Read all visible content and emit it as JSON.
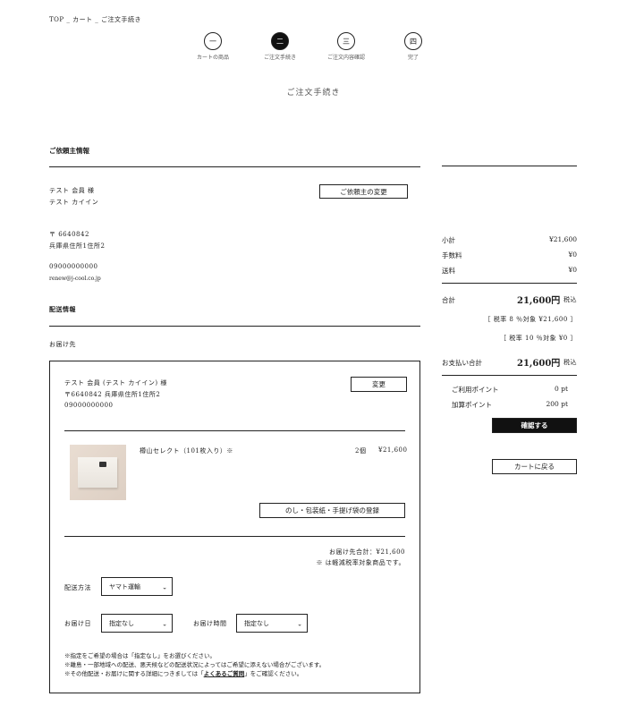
{
  "breadcrumb": "TOP _ カート _ ご注文手続き",
  "steps": [
    {
      "num": "一",
      "label": "カートの商品"
    },
    {
      "num": "二",
      "label": "ご注文手続き"
    },
    {
      "num": "三",
      "label": "ご注文内容確認"
    },
    {
      "num": "四",
      "label": "完了"
    }
  ],
  "page_title": "ご注文手続き",
  "client": {
    "section_title": "ご依頼主情報",
    "name": "テスト 会員 様",
    "kana": "テスト カイイン",
    "change_button": "ご依頼主の変更",
    "postal": "〒 6640842",
    "address": "兵庫県住所1住所2",
    "phone": "09000000000",
    "email": "renew@j-cool.co.jp"
  },
  "shipping": {
    "section_title": "配送情報",
    "destination_label": "お届け先",
    "dest_name": "テスト 会員 (テスト カイイン) 様",
    "dest_address": "〒6640842 兵庫県住所1住所2",
    "dest_phone": "09000000000",
    "change_button": "変更",
    "product_name": "樽山セレクト（101枚入り）※",
    "product_qty": "2個",
    "product_price": "¥21,600",
    "wrap_button": "のし・包装紙・手提げ袋の登録",
    "dest_total": "お届け先合計：¥21,600",
    "reduced_tax_note": "※ は軽減税率対象商品です。",
    "method_label": "配送方法",
    "method_value": "ヤマト運輸",
    "date_label": "お届け日",
    "date_value": "指定なし",
    "time_label": "お届け時間",
    "time_value": "指定なし",
    "note1": "※指定をご希望の場合は「指定なし」をお選びください。",
    "note2": "※離島・一部地域への配送、悪天候などの配送状況によってはご希望に添えない場合がございます。",
    "note3_prefix": "※その他配送・お届けに関する詳細につきましては「",
    "note3_link": "よくあるご質問",
    "note3_suffix": "」をご確認ください。"
  },
  "summary": {
    "subtotal_label": "小計",
    "subtotal_value": "¥21,600",
    "fee_label": "手数料",
    "fee_value": "¥0",
    "shipping_label": "送料",
    "shipping_value": "¥0",
    "total_label": "合計",
    "total_value": "21,600円",
    "total_tax": "税込",
    "tax8": "［ 税率 8 ％対象 ¥21,600 ］",
    "tax10": "［ 税率 10 ％対象 ¥0 ］",
    "pay_label": "お支払い合計",
    "pay_value": "21,600円",
    "pay_tax": "税込",
    "points_used_label": "ご利用ポイント",
    "points_used_value": "0 pt",
    "points_add_label": "加算ポイント",
    "points_add_value": "200 pt",
    "confirm_button": "確認する",
    "back_button": "カートに戻る"
  }
}
